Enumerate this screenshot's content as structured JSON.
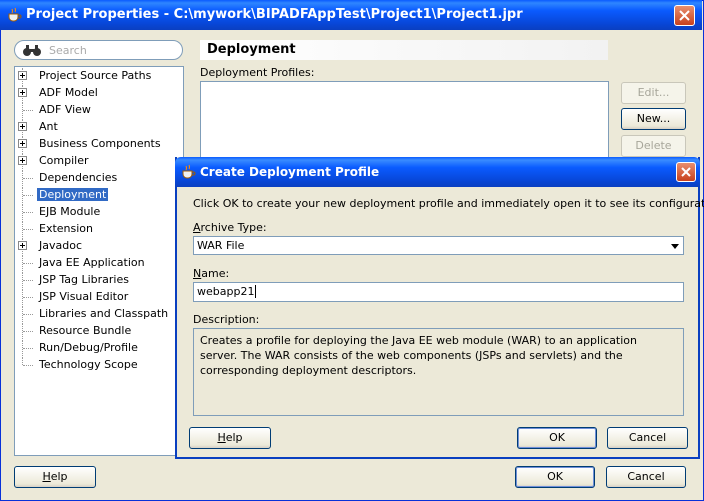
{
  "window": {
    "title": "Project Properties - C:\\mywork\\BIPADFAppTest\\Project1\\Project1.jpr"
  },
  "search": {
    "placeholder": "Search"
  },
  "tree": [
    {
      "label": "Project Source Paths",
      "expandable": true
    },
    {
      "label": "ADF Model",
      "expandable": true
    },
    {
      "label": "ADF View",
      "expandable": false
    },
    {
      "label": "Ant",
      "expandable": true
    },
    {
      "label": "Business Components",
      "expandable": true
    },
    {
      "label": "Compiler",
      "expandable": true
    },
    {
      "label": "Dependencies",
      "expandable": false
    },
    {
      "label": "Deployment",
      "expandable": false,
      "selected": true
    },
    {
      "label": "EJB Module",
      "expandable": false
    },
    {
      "label": "Extension",
      "expandable": false
    },
    {
      "label": "Javadoc",
      "expandable": true
    },
    {
      "label": "Java EE Application",
      "expandable": false
    },
    {
      "label": "JSP Tag Libraries",
      "expandable": false
    },
    {
      "label": "JSP Visual Editor",
      "expandable": false
    },
    {
      "label": "Libraries and Classpath",
      "expandable": false
    },
    {
      "label": "Resource Bundle",
      "expandable": false
    },
    {
      "label": "Run/Debug/Profile",
      "expandable": false
    },
    {
      "label": "Technology Scope",
      "expandable": false
    }
  ],
  "panel": {
    "header": "Deployment",
    "profiles_label": "Deployment Profiles:",
    "edit_button": "Edit...",
    "new_button": "New...",
    "delete_button": "Delete"
  },
  "footer": {
    "help": "Help",
    "ok": "OK",
    "cancel": "Cancel"
  },
  "dialog": {
    "title": "Create Deployment Profile",
    "intro": "Click OK to create your new deployment profile and immediately open it to see its configuration.",
    "archive_type_label": "Archive Type:",
    "archive_type_value": "WAR File",
    "name_label": "Name:",
    "name_value": "webapp21",
    "description_label": "Description:",
    "description_text": "Creates a profile for deploying the Java EE web module (WAR) to an application server. The WAR consists of the web components (JSPs and servlets) and the corresponding deployment descriptors.",
    "help": "Help",
    "ok": "OK",
    "cancel": "Cancel"
  },
  "colors": {
    "titlebar": "#0a5bff",
    "selection": "#316ac5",
    "close": "#c8411d"
  }
}
